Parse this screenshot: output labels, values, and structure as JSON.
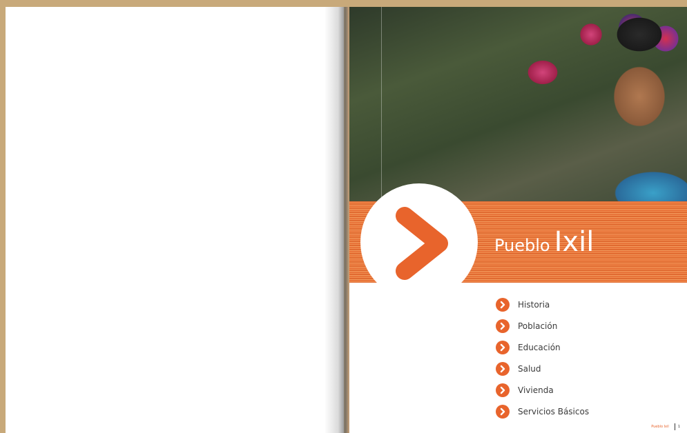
{
  "cover": {
    "title_part1": "Pueblo",
    "title_part2": "Ixil"
  },
  "menu": [
    {
      "label": "Historia"
    },
    {
      "label": "Población"
    },
    {
      "label": "Educación"
    },
    {
      "label": "Salud"
    },
    {
      "label": "Vivienda"
    },
    {
      "label": "Servicios Básicos"
    }
  ],
  "footer": {
    "running_title": "Pueblo Ixil",
    "page_number": "1"
  },
  "colors": {
    "accent": "#e8642c",
    "band": "#f08c4e",
    "text": "#3a3a3a"
  },
  "icons": {
    "chevron": "chevron-right-icon"
  }
}
